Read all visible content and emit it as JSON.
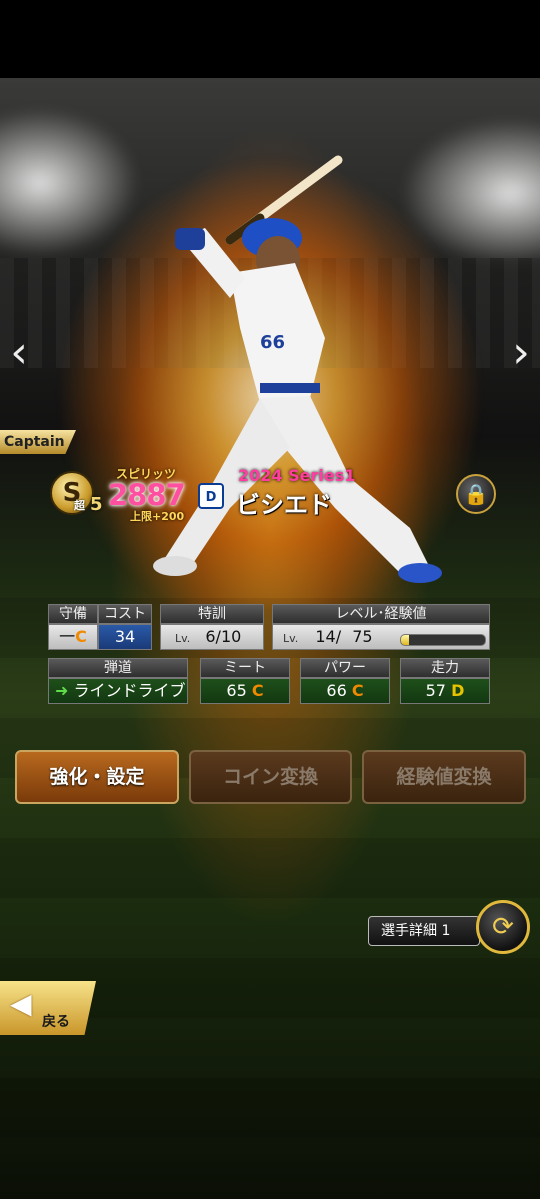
{
  "nav": {
    "prev_icon": "chevron-left-icon",
    "next_icon": "chevron-right-icon"
  },
  "captain_label": "Captain",
  "rank": {
    "letter": "S",
    "prefix": "超",
    "level": "5"
  },
  "spirit": {
    "label": "スピリッツ",
    "value": "2887",
    "limit": "上限+200"
  },
  "team_logo_text": "D",
  "series": "2024 Series1",
  "player_name": "ビシエド",
  "lock_icon": "lock-icon",
  "stats": {
    "position_header": "守備",
    "position_value": "一",
    "position_grade": "C",
    "cost_header": "コスト",
    "cost_value": "34",
    "training_header": "特訓",
    "training_lv_label": "Lv.",
    "training_value": "6/10",
    "level_header": "レベル･経験値",
    "level_lv_label": "Lv.",
    "level_value": "14/",
    "level_max": "75",
    "exp_progress": 0.1,
    "trajectory_header": "弾道",
    "trajectory_value": "ラインドライブ",
    "meet_header": "ミート",
    "meet_value": "65",
    "meet_grade": "C",
    "power_header": "パワー",
    "power_value": "66",
    "power_grade": "C",
    "speed_header": "走力",
    "speed_value": "57",
    "speed_grade": "D"
  },
  "buttons": {
    "enhance": "強化・設定",
    "coin_convert": "コイン変換",
    "exp_convert": "経験値変換"
  },
  "detail": {
    "label": "選手詳細 1",
    "switch_icon": "swap-icon"
  },
  "back": {
    "label": "戻る",
    "icon": "back-arrow-icon"
  }
}
